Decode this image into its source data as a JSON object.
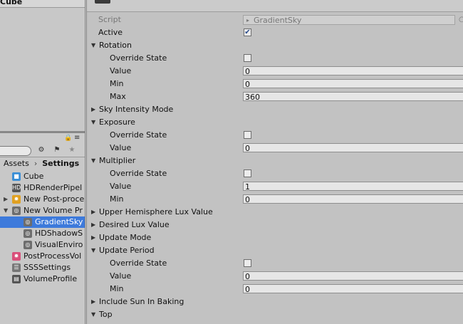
{
  "hierarchy": {
    "visible_item": "Cube"
  },
  "project": {
    "breadcrumb": [
      "Assets",
      "Settings"
    ],
    "items": [
      {
        "label": "Cube",
        "icon": "cube-icon",
        "indent": 0,
        "expander": ""
      },
      {
        "label": "HDRenderPipel",
        "icon": "hd-asset-icon",
        "indent": 0,
        "expander": ""
      },
      {
        "label": "New Post-proce",
        "icon": "post-process-icon",
        "indent": 0,
        "expander": "collapsed"
      },
      {
        "label": "New Volume Pr",
        "icon": "volume-profile-icon",
        "indent": 0,
        "expander": "expanded"
      },
      {
        "label": "GradientSky",
        "icon": "settings-asset-icon",
        "indent": 1,
        "expander": "",
        "selected": true
      },
      {
        "label": "HDShadowS",
        "icon": "settings-asset-icon",
        "indent": 1,
        "expander": ""
      },
      {
        "label": "VisualEnviro",
        "icon": "settings-asset-icon",
        "indent": 1,
        "expander": ""
      },
      {
        "label": "PostProcessVol",
        "icon": "post-process-volume-icon",
        "indent": 0,
        "expander": ""
      },
      {
        "label": "SSSSettings",
        "icon": "sss-settings-icon",
        "indent": 0,
        "expander": ""
      },
      {
        "label": "VolumeProfile",
        "icon": "volume-profile-asset-icon",
        "indent": 0,
        "expander": ""
      }
    ]
  },
  "inspector": {
    "script_label": "Script",
    "script_value": "GradientSky",
    "rows": [
      {
        "type": "checkbox",
        "label": "Active",
        "level": 0,
        "checked": true
      },
      {
        "type": "foldout",
        "label": "Rotation",
        "expanded": true
      },
      {
        "type": "checkbox",
        "label": "Override State",
        "level": 1,
        "checked": false
      },
      {
        "type": "field",
        "label": "Value",
        "level": 1,
        "value": "0"
      },
      {
        "type": "field",
        "label": "Min",
        "level": 1,
        "value": "0"
      },
      {
        "type": "field",
        "label": "Max",
        "level": 1,
        "value": "360"
      },
      {
        "type": "foldout",
        "label": "Sky Intensity Mode",
        "expanded": false
      },
      {
        "type": "foldout",
        "label": "Exposure",
        "expanded": true
      },
      {
        "type": "checkbox",
        "label": "Override State",
        "level": 1,
        "checked": false
      },
      {
        "type": "field",
        "label": "Value",
        "level": 1,
        "value": "0"
      },
      {
        "type": "foldout",
        "label": "Multiplier",
        "expanded": true
      },
      {
        "type": "checkbox",
        "label": "Override State",
        "level": 1,
        "checked": false
      },
      {
        "type": "field",
        "label": "Value",
        "level": 1,
        "value": "1"
      },
      {
        "type": "field",
        "label": "Min",
        "level": 1,
        "value": "0"
      },
      {
        "type": "foldout",
        "label": "Upper Hemisphere Lux Value",
        "expanded": false
      },
      {
        "type": "foldout",
        "label": "Desired Lux Value",
        "expanded": false
      },
      {
        "type": "foldout",
        "label": "Update Mode",
        "expanded": false
      },
      {
        "type": "foldout",
        "label": "Update Period",
        "expanded": true
      },
      {
        "type": "checkbox",
        "label": "Override State",
        "level": 1,
        "checked": false
      },
      {
        "type": "field",
        "label": "Value",
        "level": 1,
        "value": "0"
      },
      {
        "type": "field",
        "label": "Min",
        "level": 1,
        "value": "0"
      },
      {
        "type": "foldout",
        "label": "Include Sun In Baking",
        "expanded": false
      },
      {
        "type": "foldout",
        "label": "Top",
        "expanded": true
      }
    ]
  },
  "colors": {
    "selection": "#3d7adb",
    "panel": "#c2c2c2",
    "checkmark": "#2a4b8a"
  }
}
